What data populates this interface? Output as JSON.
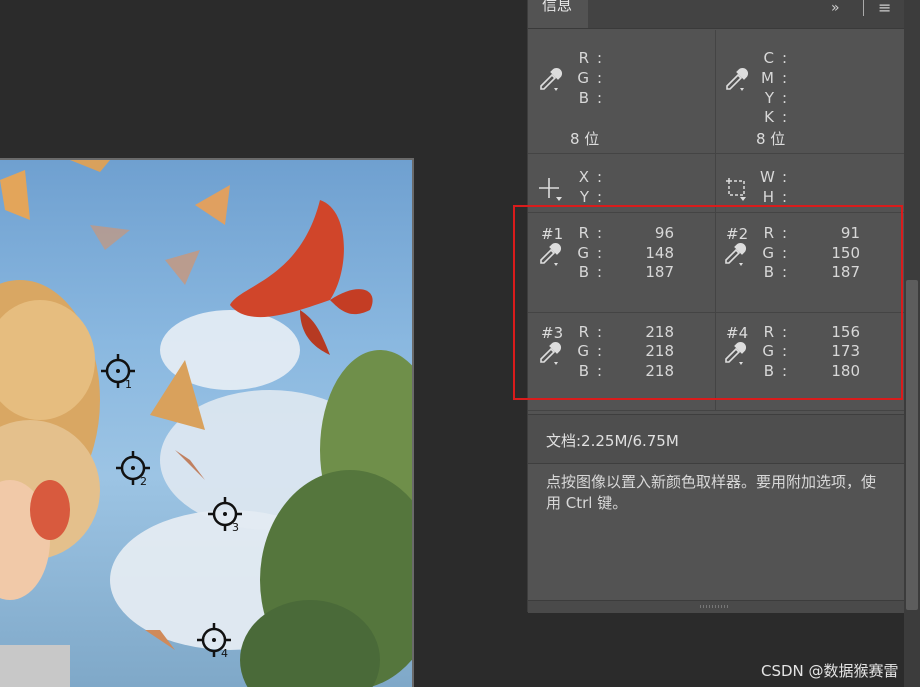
{
  "panel": {
    "tab_label": "信息",
    "collapse_label": "»",
    "menu_label": "≡",
    "rgb_block": {
      "labels": [
        "R",
        "G",
        "B"
      ],
      "bits": "8 位"
    },
    "cmyk_block": {
      "labels": [
        "C",
        "M",
        "Y",
        "K"
      ],
      "bits": "8 位"
    },
    "xy_block": {
      "labels": [
        "X",
        "Y"
      ]
    },
    "wh_block": {
      "labels": [
        "W",
        "H"
      ]
    },
    "samplers": [
      {
        "id": "#1",
        "R": "96",
        "G": "148",
        "B": "187"
      },
      {
        "id": "#2",
        "R": "91",
        "G": "150",
        "B": "187"
      },
      {
        "id": "#3",
        "R": "218",
        "G": "218",
        "B": "218"
      },
      {
        "id": "#4",
        "R": "156",
        "G": "173",
        "B": "180"
      }
    ],
    "doc_info": "文档:2.25M/6.75M",
    "hint": "点按图像以置入新颜色取样器。要用附加选项，使用 Ctrl 键。"
  },
  "image": {
    "sampler_markers": [
      "1",
      "2",
      "3",
      "4"
    ]
  },
  "watermark": "CSDN @数据猴赛雷",
  "colors": {
    "highlight": "#d91c1c",
    "panel": "#535353"
  }
}
